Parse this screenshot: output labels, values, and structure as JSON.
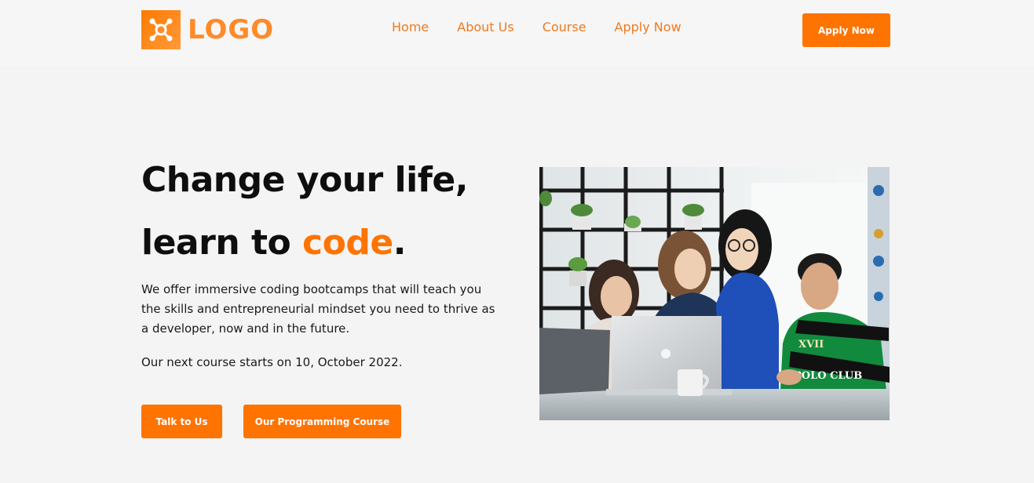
{
  "header": {
    "logo_text": "LOGO",
    "nav": [
      {
        "label": "Home"
      },
      {
        "label": "About Us"
      },
      {
        "label": "Course"
      },
      {
        "label": "Apply Now"
      }
    ],
    "cta_label": "Apply Now"
  },
  "hero": {
    "title_line1": "Change your life,",
    "title_line2_prefix": "learn to ",
    "title_line2_accent": "code",
    "title_line2_suffix": ".",
    "description": "We offer immersive coding bootcamps that will teach you the skills and entrepreneurial mindset you need to thrive as a developer, now and in the future.",
    "next_course": "Our next course starts on 10, October 2022.",
    "buttons": {
      "talk": "Talk to Us",
      "course": "Our Programming Course"
    }
  },
  "photo": {
    "icon": "team-photo",
    "shirt_text_1": "XVII",
    "shirt_text_2": "POLO CLUB"
  },
  "colors": {
    "accent": "#ff7300",
    "nav_text": "#ef7a1e",
    "background": "#f4f4f4",
    "heading": "#0e0e0e"
  }
}
